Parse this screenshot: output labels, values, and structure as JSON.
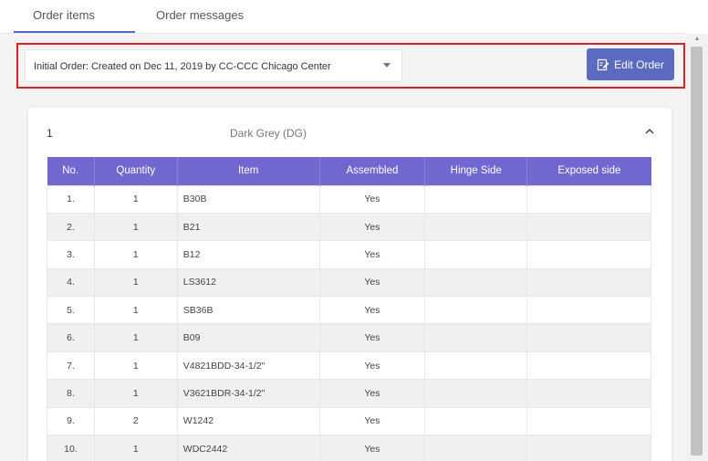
{
  "tabs": [
    {
      "label": "Order items"
    },
    {
      "label": "Order messages"
    }
  ],
  "order_select": {
    "value": "Initial Order: Created on Dec 11, 2019 by CC-CCC Chicago Center"
  },
  "edit_button": {
    "label": "Edit Order"
  },
  "group": {
    "number": "1",
    "color": "Dark Grey (DG)"
  },
  "table": {
    "headers": [
      "No.",
      "Quantity",
      "Item",
      "Assembled",
      "Hinge Side",
      "Exposed side"
    ],
    "rows": [
      {
        "no": "1.",
        "qty": "1",
        "item": "B30B",
        "assembled": "Yes",
        "hinge": "",
        "exposed": ""
      },
      {
        "no": "2.",
        "qty": "1",
        "item": "B21",
        "assembled": "Yes",
        "hinge": "",
        "exposed": ""
      },
      {
        "no": "3.",
        "qty": "1",
        "item": "B12",
        "assembled": "Yes",
        "hinge": "",
        "exposed": ""
      },
      {
        "no": "4.",
        "qty": "1",
        "item": "LS3612",
        "assembled": "Yes",
        "hinge": "",
        "exposed": ""
      },
      {
        "no": "5.",
        "qty": "1",
        "item": "SB36B",
        "assembled": "Yes",
        "hinge": "",
        "exposed": ""
      },
      {
        "no": "6.",
        "qty": "1",
        "item": "B09",
        "assembled": "Yes",
        "hinge": "",
        "exposed": ""
      },
      {
        "no": "7.",
        "qty": "1",
        "item": "V4821BDD-34-1/2\"",
        "assembled": "Yes",
        "hinge": "",
        "exposed": ""
      },
      {
        "no": "8.",
        "qty": "1",
        "item": "V3621BDR-34-1/2\"",
        "assembled": "Yes",
        "hinge": "",
        "exposed": ""
      },
      {
        "no": "9.",
        "qty": "2",
        "item": "W1242",
        "assembled": "Yes",
        "hinge": "",
        "exposed": ""
      },
      {
        "no": "10.",
        "qty": "1",
        "item": "WDC2442",
        "assembled": "Yes",
        "hinge": "",
        "exposed": ""
      }
    ]
  },
  "colors": {
    "accent": "#5c6bc0",
    "table_header": "#7067cf",
    "highlight": "#e02020"
  }
}
